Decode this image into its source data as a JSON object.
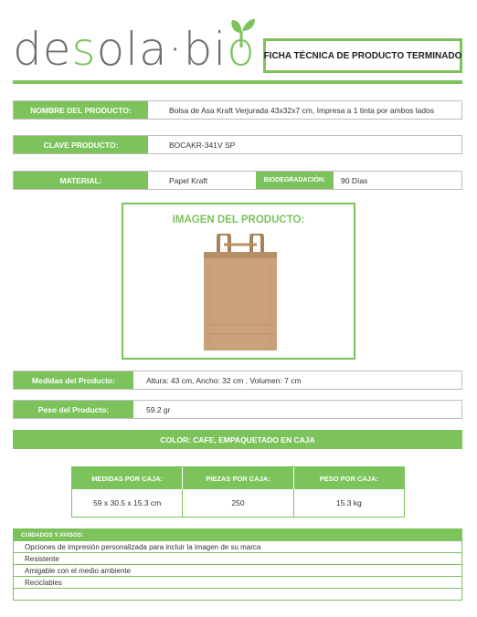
{
  "brand": {
    "logo_text": "desolabio",
    "logo_part1": "de",
    "logo_part2": "s",
    "logo_part3": "ola",
    "logo_part4": "·bi",
    "logo_part5": "o"
  },
  "header": {
    "title": "FICHA TÉCNICA DE PRODUCTO TERMINADO"
  },
  "product_name": {
    "label": "NOMBRE DEL PRODUCTO:",
    "value": "Bolsa de Asa Kraft Verjurada 43x32x7 cm, Impresa a 1 tinta por ambos lados"
  },
  "product_key": {
    "label": "CLAVE PRODUCTO:",
    "value": "BOCAKR-341V SP"
  },
  "material": {
    "label": "MATERIAL:",
    "value": "Papel Kraft",
    "bio_label": "BIODEGRADACIÓN:",
    "bio_value": "90 Días"
  },
  "image": {
    "title": "IMAGEN DEL PRODUCTO:"
  },
  "measures": {
    "label": "Medidas del Producto:",
    "value": "Altura: 43 cm, Ancho: 32 cm , Volumen:  7 cm"
  },
  "weight": {
    "label": "Peso del Producto:",
    "value": "59.2 gr"
  },
  "color_line": "COLOR: CAFE, EMPAQUETADO EN CAJA",
  "box_table": {
    "headers": [
      "MEDIDAS POR CAJA:",
      "PIEZAS POR CAJA:",
      "PESO POR CAJA:"
    ],
    "values": [
      "59 x 30.5 x 15.3 cm",
      "250",
      "15.3 kg"
    ]
  },
  "care": {
    "title": "CUIDADOS Y AVISOS:",
    "items": [
      "Opciones de impresión personalizada para incluir la imagen de su marca",
      "Resistente",
      "Amigable con el medio ambiente",
      "Reciclables"
    ]
  },
  "colors": {
    "accent": "#7cc35c",
    "logo_gray": "#6d6e71",
    "kraft": "#c9a27a"
  }
}
